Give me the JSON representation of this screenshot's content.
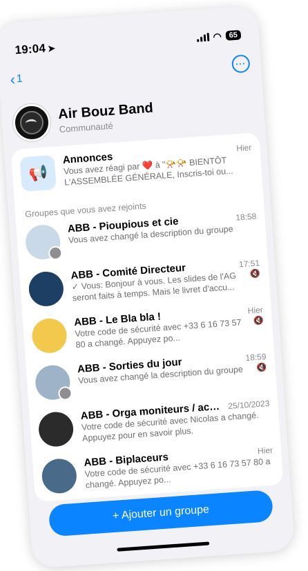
{
  "status_bar": {
    "time": "19:04",
    "battery": "65"
  },
  "nav": {
    "back_count": "1"
  },
  "community": {
    "name": "Air Bouz Band",
    "subtitle": "Communauté"
  },
  "announcements": {
    "title": "Annonces",
    "time": "Hier",
    "snippet": "Vous avez réagi par ❤️ à \"📯📯 BIENTÔT L'ASSEMBLÉE GÉNÉRALE, Inscris-toi ou..."
  },
  "section_header": "Groupes que vous avez rejoints",
  "groups": [
    {
      "name": "ABB - Pioupious et cie",
      "time": "18:58",
      "snippet": "Vous avez changé la description du groupe",
      "muted": false,
      "avatar_color": "#c9d9e8"
    },
    {
      "name": "ABB - Comité Directeur",
      "time": "17:51",
      "snippet": "✓ Vous: Bonjour à vous.  Les slides de l'AG seront faits à temps. Mais le livret d'accu...",
      "muted": true,
      "avatar_color": "#1d3f63"
    },
    {
      "name": "ABB - Le Bla bla !",
      "time": "Hier",
      "snippet": "Votre code de sécurité avec +33 6 16 73 57 80 a changé. Appuyez po...",
      "muted": true,
      "avatar_color": "#f2c94c"
    },
    {
      "name": "ABB - Sorties du jour",
      "time": "18:59",
      "snippet": "Vous avez changé la description du groupe",
      "muted": true,
      "avatar_color": "#9fb3c8"
    },
    {
      "name": "ABB - Orga moniteurs / acco...",
      "time": "25/10/2023",
      "snippet": "Votre code de sécurité avec Nicolas a changé. Appuyez pour en savoir plus.",
      "muted": false,
      "avatar_color": "#2b2b2b"
    },
    {
      "name": "ABB - Biplaceurs",
      "time": "Hier",
      "snippet": "Votre code de sécurité avec +33 6 16 73 57 80 a changé. Appuyez po...",
      "muted": false,
      "avatar_color": "#4a6a8a"
    }
  ],
  "add_button": {
    "label": "+ Ajouter un groupe"
  },
  "colors": {
    "accent": "#0a84ff",
    "background": "#f2f2f6"
  }
}
